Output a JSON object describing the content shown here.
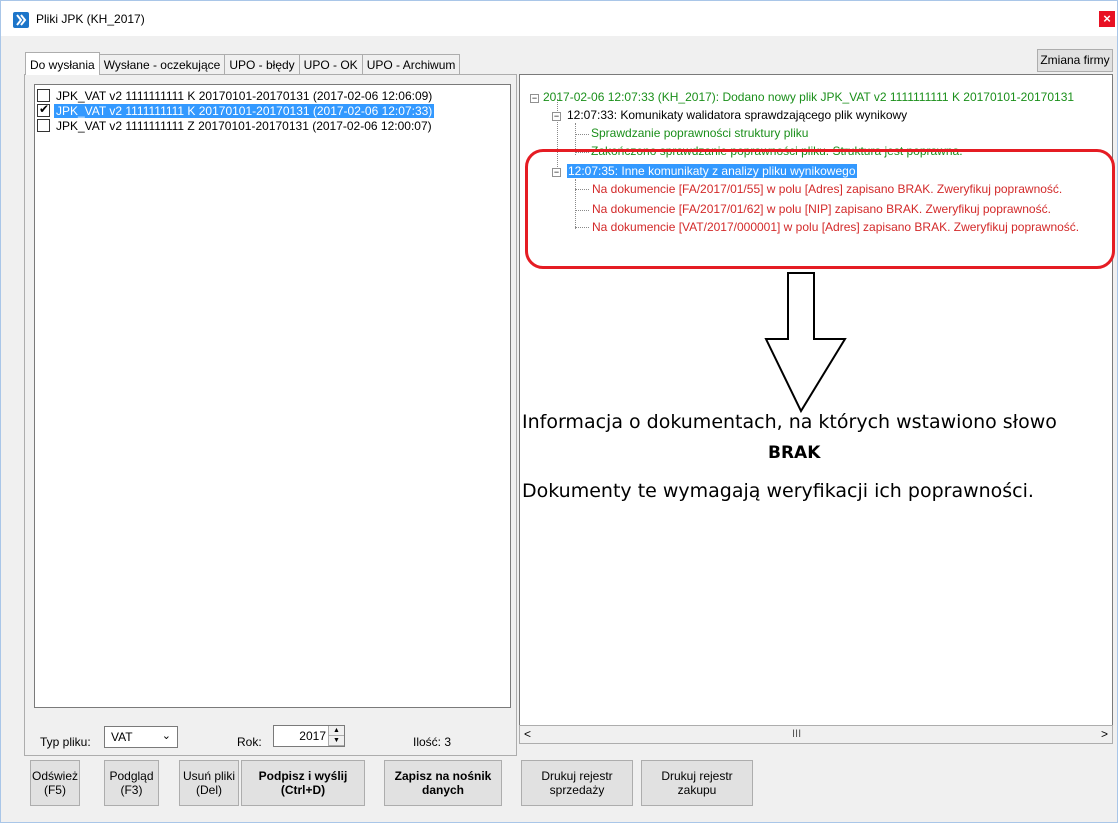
{
  "window": {
    "title": "Pliki JPK (KH_2017)",
    "close_glyph": "×"
  },
  "tabs": [
    {
      "label": "Do wysłania",
      "active": true
    },
    {
      "label": "Wysłane - oczekujące",
      "active": false
    },
    {
      "label": "UPO - błędy",
      "active": false
    },
    {
      "label": "UPO - OK",
      "active": false
    },
    {
      "label": "UPO - Archiwum",
      "active": false
    }
  ],
  "zmiana_firmy_label": "Zmiana firmy",
  "files": [
    {
      "label": "JPK_VAT v2  1111111111 K 20170101-20170131 (2017-02-06 12:06:09)",
      "checked": false,
      "selected": false
    },
    {
      "label": "JPK_VAT v2  1111111111 K 20170101-20170131 (2017-02-06 12:07:33)",
      "checked": true,
      "selected": true
    },
    {
      "label": "JPK_VAT v2  1111111111 Z 20170101-20170131 (2017-02-06 12:00:07)",
      "checked": false,
      "selected": false
    }
  ],
  "filters": {
    "typ_label": "Typ pliku:",
    "typ_value": "VAT",
    "rok_label": "Rok:",
    "rok_value": "2017",
    "ilosc_label": "Ilość: 3"
  },
  "buttons": {
    "odswiez": "Odśwież\n(F5)",
    "podglad": "Podgląd\n(F3)",
    "usun": "Usuń pliki\n(Del)",
    "podpisz": "Podpisz i wyślij\n(Ctrl+D)",
    "zapisz": "Zapisz na nośnik\ndanych",
    "drukuj_sprzedazy": "Drukuj rejestr\nsprzedaży",
    "drukuj_zakupu": "Drukuj rejestr\nzakupu"
  },
  "tree": {
    "root": "2017-02-06 12:07:33 (KH_2017): Dodano nowy plik JPK_VAT v2  1111111111 K 20170101-20170131",
    "validator": "12:07:33: Komunikaty walidatora sprawdzającego plik wynikowy",
    "check_structure": "Sprawdzanie poprawności struktury pliku",
    "check_done": "Zakończono sprawdzanie poprawności pliku. Struktura jest poprawna.",
    "other": "12:07:35: Inne komunikaty z analizy pliku wynikowego",
    "msg1": "Na dokumencie [FA/2017/01/55] w polu [Adres] zapisano BRAK. Zweryfikuj poprawność.",
    "msg2": "Na dokumencie [FA/2017/01/62] w polu [NIP] zapisano BRAK. Zweryfikuj poprawność.",
    "msg3": "Na dokumencie [VAT/2017/000001] w polu [Adres] zapisano BRAK. Zweryfikuj poprawność."
  },
  "annotation": {
    "line1": "Informacja o dokumentach, na których wstawiono słowo",
    "line2": "BRAK",
    "line3": "Dokumenty te wymagają weryfikacji ich poprawności."
  },
  "scrollbar": {
    "left": "<",
    "right": ">",
    "thumb": "III"
  },
  "colors": {
    "selection": "#3399ff",
    "green_text": "#1a8f1a",
    "red_text": "#d32a2a",
    "frame": "#e51c23"
  }
}
